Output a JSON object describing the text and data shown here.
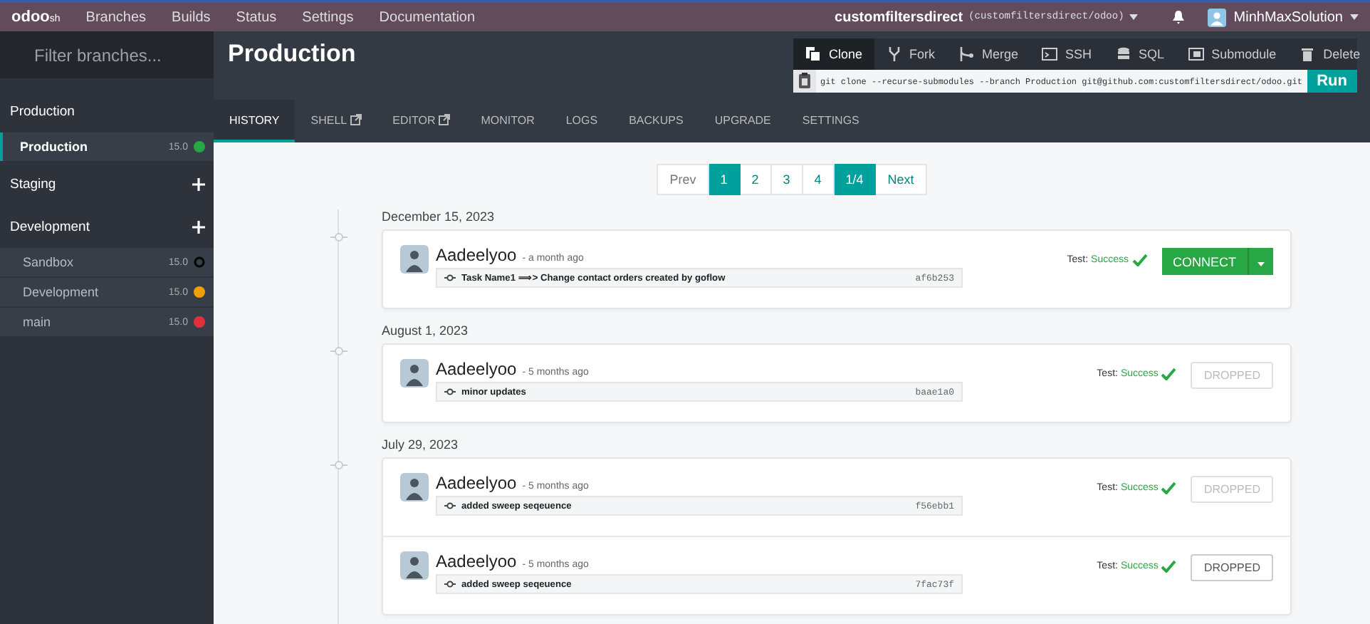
{
  "topbar": {
    "logo": "odoo",
    "logo_suffix": "sh",
    "nav": [
      "Branches",
      "Builds",
      "Status",
      "Settings",
      "Documentation"
    ],
    "project": "customfiltersdirect",
    "project_repo": "(customfiltersdirect/odoo)",
    "user": "MinhMaxSolution"
  },
  "sidebar": {
    "filter": {
      "placeholder": "Filter branches..."
    },
    "sections": [
      {
        "title": "Production",
        "addable": false,
        "branches": [
          {
            "name": "Production",
            "version": "15.0",
            "color": "#28a745",
            "kind": "dot",
            "selected": true
          }
        ]
      },
      {
        "title": "Staging",
        "addable": true
      },
      {
        "title": "Development",
        "addable": true,
        "branches": [
          {
            "name": "Sandbox",
            "version": "15.0",
            "color": "#000000",
            "kind": "ring",
            "selected": false
          },
          {
            "name": "Development",
            "version": "15.0",
            "color": "#f0a000",
            "kind": "dot",
            "selected": false
          },
          {
            "name": "main",
            "version": "15.0",
            "color": "#e0303c",
            "kind": "dot",
            "selected": false
          }
        ]
      }
    ]
  },
  "header": {
    "title": "Production",
    "actions": [
      {
        "label": "Clone",
        "selected": true
      },
      {
        "label": "Fork",
        "selected": false
      },
      {
        "label": "Merge",
        "selected": false
      },
      {
        "label": "SSH",
        "selected": false
      },
      {
        "label": "SQL",
        "selected": false
      },
      {
        "label": "Submodule",
        "selected": false
      },
      {
        "label": "Delete",
        "selected": false
      }
    ],
    "command": "git clone --recurse-submodules --branch Production git@github.com:customfiltersdirect/odoo.git",
    "run": "Run"
  },
  "tabs": [
    {
      "label": "HISTORY",
      "external": false,
      "selected": true
    },
    {
      "label": "SHELL",
      "external": true,
      "selected": false
    },
    {
      "label": "EDITOR",
      "external": true,
      "selected": false
    },
    {
      "label": "MONITOR",
      "external": false,
      "selected": false
    },
    {
      "label": "LOGS",
      "external": false,
      "selected": false
    },
    {
      "label": "BACKUPS",
      "external": false,
      "selected": false
    },
    {
      "label": "UPGRADE",
      "external": false,
      "selected": false
    },
    {
      "label": "SETTINGS",
      "external": false,
      "selected": false
    }
  ],
  "pagination": [
    {
      "label": "Prev",
      "selected": false
    },
    {
      "label": "1",
      "selected": true
    },
    {
      "label": "2",
      "selected": false
    },
    {
      "label": "3",
      "selected": false
    },
    {
      "label": "4",
      "selected": false
    },
    {
      "label": "1/4",
      "selected": true
    },
    {
      "label": "Next",
      "selected": false
    }
  ],
  "history": [
    {
      "date": "December 15, 2023",
      "commits": [
        {
          "author": "Aadeelyoo",
          "time": "- a month ago",
          "message": "Task Name1 ⟹> Change contact orders created by goflow",
          "hash": "af6b253",
          "test_label": "Test:",
          "test_result": "Success",
          "action": {
            "kind": "connect",
            "label": "CONNECT",
            "disabled": false
          }
        }
      ]
    },
    {
      "date": "August 1, 2023",
      "commits": [
        {
          "author": "Aadeelyoo",
          "time": "- 5 months ago",
          "message": "minor updates",
          "hash": "baae1a0",
          "test_label": "Test:",
          "test_result": "Success",
          "action": {
            "kind": "dropped",
            "label": "DROPPED",
            "disabled": true
          }
        }
      ]
    },
    {
      "date": "July 29, 2023",
      "commits": [
        {
          "author": "Aadeelyoo",
          "time": "- 5 months ago",
          "message": "added sweep seqeuence",
          "hash": "f56ebb1",
          "test_label": "Test:",
          "test_result": "Success",
          "action": {
            "kind": "dropped",
            "label": "DROPPED",
            "disabled": true
          }
        },
        {
          "author": "Aadeelyoo",
          "time": "- 5 months ago",
          "message": "added sweep seqeuence",
          "hash": "7fac73f",
          "test_label": "Test:",
          "test_result": "Success",
          "action": {
            "kind": "dropped",
            "label": "DROPPED",
            "disabled": false
          }
        }
      ]
    }
  ]
}
